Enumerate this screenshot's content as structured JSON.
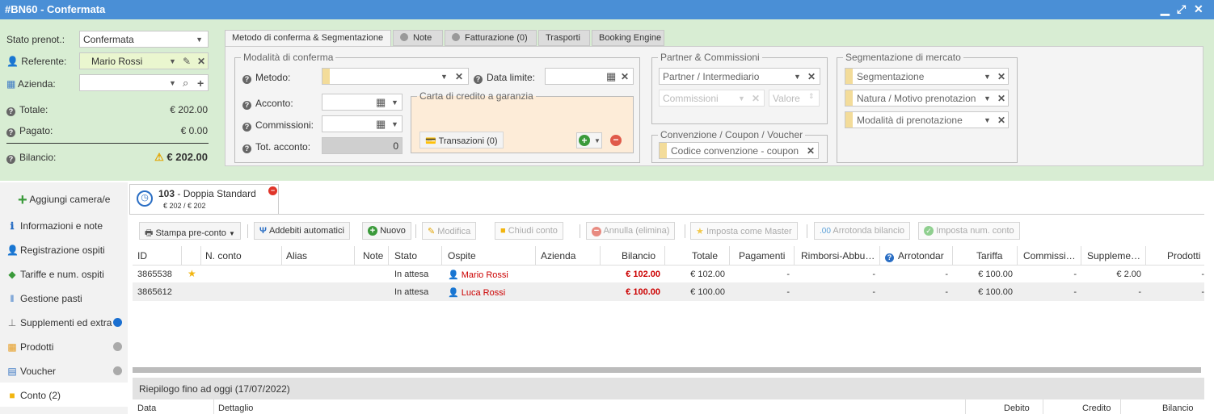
{
  "window": {
    "title": "#BN60 - Confermata",
    "minimize": "▁",
    "maximize": "⤢",
    "close": "✕"
  },
  "left_form": {
    "stato_label": "Stato prenot.:",
    "stato_value": "Confermata",
    "referente_label": "Referente:",
    "referente_value": "Mario Rossi",
    "azienda_label": "Azienda:",
    "totale_label": "Totale:",
    "totale_value": "€ 202.00",
    "pagato_label": "Pagato:",
    "pagato_value": "€ 0.00",
    "bilancio_label": "Bilancio:",
    "bilancio_value": "€ 202.00"
  },
  "tabs": [
    {
      "label": "Metodo di conferma & Segmentazione",
      "active": true
    },
    {
      "label": "Note"
    },
    {
      "label": "Fatturazione (0)"
    },
    {
      "label": "Trasporti"
    },
    {
      "label": "Booking Engine"
    }
  ],
  "modalita": {
    "legend": "Modalità di conferma",
    "metodo_label": "Metodo:",
    "data_limite_label": "Data limite:",
    "acconto_label": "Acconto:",
    "commissioni_label": "Commissioni:",
    "tot_acconto_label": "Tot. acconto:",
    "tot_acconto_value": "0",
    "carta_legend": "Carta di credito a garanzia",
    "transazioni_label": "Transazioni (0)"
  },
  "partner": {
    "legend": "Partner & Commissioni",
    "partner_placeholder": "Partner / Intermediario",
    "commissioni_placeholder": "Commissioni",
    "valore_placeholder": "Valore"
  },
  "convenzione": {
    "legend": "Convenzione / Coupon / Voucher",
    "placeholder": "Codice convenzione - coupon"
  },
  "segmentazione": {
    "legend": "Segmentazione di mercato",
    "seg_placeholder": "Segmentazione",
    "natura_placeholder": "Natura / Motivo prenotazion",
    "modalita_placeholder": "Modalità di prenotazione"
  },
  "sidebar": {
    "add_label": "Aggiungi camera/e",
    "items": [
      {
        "label": "Informazioni e note",
        "icon": "info-icon"
      },
      {
        "label": "Registrazione ospiti",
        "icon": "guest-icon"
      },
      {
        "label": "Tariffe e num. ospiti",
        "icon": "tag-icon"
      },
      {
        "label": "Gestione pasti",
        "icon": "cutlery-icon"
      },
      {
        "label": "Supplementi ed extra",
        "icon": "bell-icon",
        "dot": "#1a6fd0"
      },
      {
        "label": "Prodotti",
        "icon": "boxes-icon",
        "dot": "#aaaaaa"
      },
      {
        "label": "Voucher",
        "icon": "voucher-icon",
        "dot": "#aaaaaa"
      },
      {
        "label": "Conto (2)",
        "icon": "folder-icon",
        "active": true
      }
    ]
  },
  "room_tab": {
    "number": "103",
    "sep": " - ",
    "name": "Doppia Standard",
    "amount": "€ 202 / € 202"
  },
  "toolbar": {
    "stampa": "Stampa pre-conto",
    "addebiti": "Addebiti automatici",
    "nuovo": "Nuovo",
    "modifica": "Modifica",
    "chiudi": "Chiudi conto",
    "annulla": "Annulla (elimina)",
    "master": "Imposta come Master",
    "arrotonda": "Arrotonda bilancio",
    "num_conto": "Imposta num. conto"
  },
  "grid": {
    "headers": [
      "ID",
      "N. conto",
      "Alias",
      "Note",
      "Stato",
      "Ospite",
      "Azienda",
      "Bilancio",
      "Totale",
      "Pagamenti",
      "Rimborsi-Abbu…",
      "Arrotondar",
      "Tariffa",
      "Commissi…",
      "Suppleme…",
      "Prodotti"
    ],
    "rows": [
      {
        "id": "3865538",
        "star": "★",
        "stato": "In attesa",
        "ospite": "Mario Rossi",
        "bilancio": "€ 102.00",
        "totale": "€ 102.00",
        "pagamenti": "-",
        "rimborsi": "-",
        "arrotondar": "-",
        "tariffa": "€ 100.00",
        "commissioni": "-",
        "supplementi": "€ 2.00",
        "prodotti": "-"
      },
      {
        "id": "3865612",
        "star": "",
        "stato": "In attesa",
        "ospite": "Luca Rossi",
        "bilancio": "€ 100.00",
        "totale": "€ 100.00",
        "pagamenti": "-",
        "rimborsi": "-",
        "arrotondar": "-",
        "tariffa": "€ 100.00",
        "commissioni": "-",
        "supplementi": "-",
        "prodotti": "-"
      }
    ]
  },
  "summary": {
    "title": "Riepilogo fino ad oggi (17/07/2022)",
    "cols": [
      "Data",
      "Dettaglio",
      "Debito",
      "Credito",
      "Bilancio"
    ]
  },
  "colors": {
    "titlebar": "#4a8fd6",
    "panel_bg": "#d8edd3",
    "accent_red": "#cc0000"
  }
}
